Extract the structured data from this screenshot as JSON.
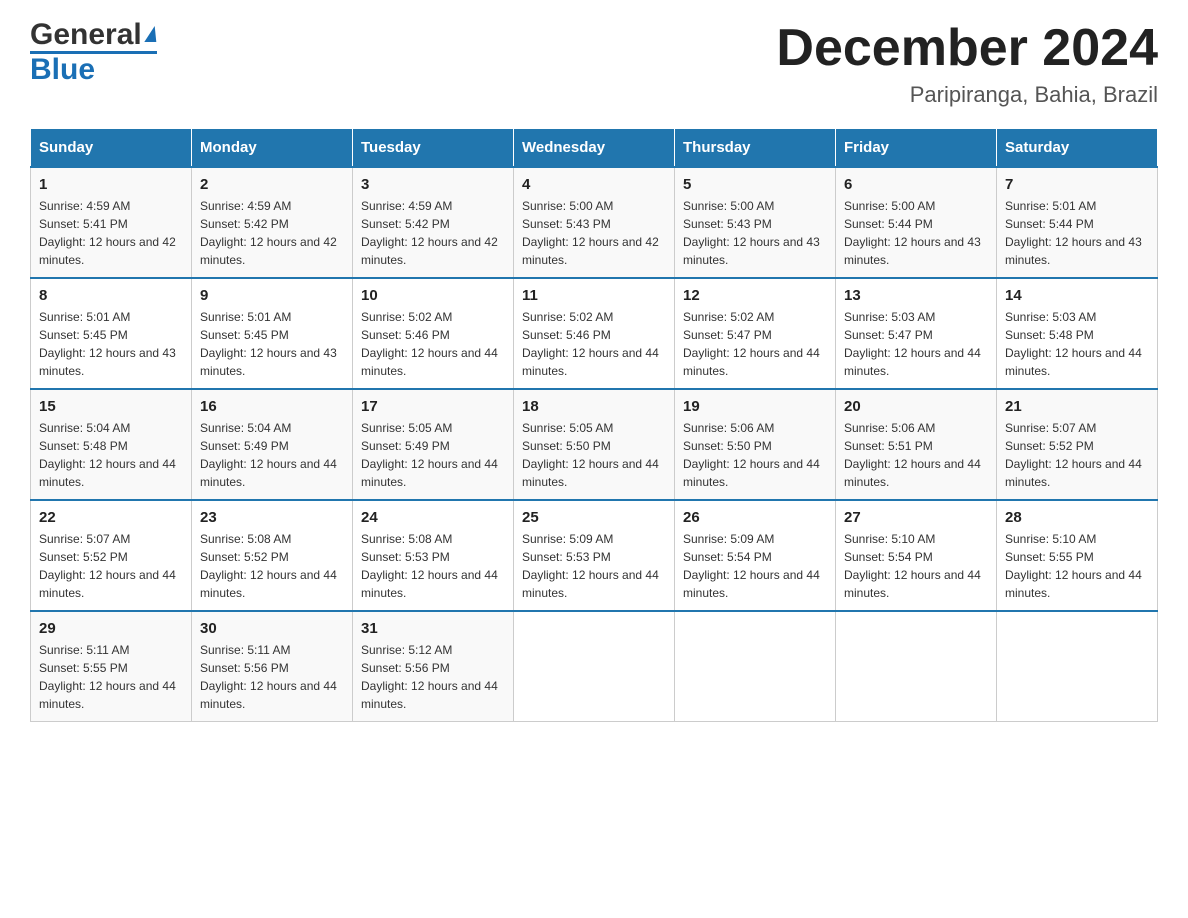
{
  "header": {
    "logo_line1": "General",
    "logo_line2": "Blue",
    "month_title": "December 2024",
    "location": "Paripiranga, Bahia, Brazil"
  },
  "days_of_week": [
    "Sunday",
    "Monday",
    "Tuesday",
    "Wednesday",
    "Thursday",
    "Friday",
    "Saturday"
  ],
  "weeks": [
    [
      {
        "day": "1",
        "sunrise": "Sunrise: 4:59 AM",
        "sunset": "Sunset: 5:41 PM",
        "daylight": "Daylight: 12 hours and 42 minutes."
      },
      {
        "day": "2",
        "sunrise": "Sunrise: 4:59 AM",
        "sunset": "Sunset: 5:42 PM",
        "daylight": "Daylight: 12 hours and 42 minutes."
      },
      {
        "day": "3",
        "sunrise": "Sunrise: 4:59 AM",
        "sunset": "Sunset: 5:42 PM",
        "daylight": "Daylight: 12 hours and 42 minutes."
      },
      {
        "day": "4",
        "sunrise": "Sunrise: 5:00 AM",
        "sunset": "Sunset: 5:43 PM",
        "daylight": "Daylight: 12 hours and 42 minutes."
      },
      {
        "day": "5",
        "sunrise": "Sunrise: 5:00 AM",
        "sunset": "Sunset: 5:43 PM",
        "daylight": "Daylight: 12 hours and 43 minutes."
      },
      {
        "day": "6",
        "sunrise": "Sunrise: 5:00 AM",
        "sunset": "Sunset: 5:44 PM",
        "daylight": "Daylight: 12 hours and 43 minutes."
      },
      {
        "day": "7",
        "sunrise": "Sunrise: 5:01 AM",
        "sunset": "Sunset: 5:44 PM",
        "daylight": "Daylight: 12 hours and 43 minutes."
      }
    ],
    [
      {
        "day": "8",
        "sunrise": "Sunrise: 5:01 AM",
        "sunset": "Sunset: 5:45 PM",
        "daylight": "Daylight: 12 hours and 43 minutes."
      },
      {
        "day": "9",
        "sunrise": "Sunrise: 5:01 AM",
        "sunset": "Sunset: 5:45 PM",
        "daylight": "Daylight: 12 hours and 43 minutes."
      },
      {
        "day": "10",
        "sunrise": "Sunrise: 5:02 AM",
        "sunset": "Sunset: 5:46 PM",
        "daylight": "Daylight: 12 hours and 44 minutes."
      },
      {
        "day": "11",
        "sunrise": "Sunrise: 5:02 AM",
        "sunset": "Sunset: 5:46 PM",
        "daylight": "Daylight: 12 hours and 44 minutes."
      },
      {
        "day": "12",
        "sunrise": "Sunrise: 5:02 AM",
        "sunset": "Sunset: 5:47 PM",
        "daylight": "Daylight: 12 hours and 44 minutes."
      },
      {
        "day": "13",
        "sunrise": "Sunrise: 5:03 AM",
        "sunset": "Sunset: 5:47 PM",
        "daylight": "Daylight: 12 hours and 44 minutes."
      },
      {
        "day": "14",
        "sunrise": "Sunrise: 5:03 AM",
        "sunset": "Sunset: 5:48 PM",
        "daylight": "Daylight: 12 hours and 44 minutes."
      }
    ],
    [
      {
        "day": "15",
        "sunrise": "Sunrise: 5:04 AM",
        "sunset": "Sunset: 5:48 PM",
        "daylight": "Daylight: 12 hours and 44 minutes."
      },
      {
        "day": "16",
        "sunrise": "Sunrise: 5:04 AM",
        "sunset": "Sunset: 5:49 PM",
        "daylight": "Daylight: 12 hours and 44 minutes."
      },
      {
        "day": "17",
        "sunrise": "Sunrise: 5:05 AM",
        "sunset": "Sunset: 5:49 PM",
        "daylight": "Daylight: 12 hours and 44 minutes."
      },
      {
        "day": "18",
        "sunrise": "Sunrise: 5:05 AM",
        "sunset": "Sunset: 5:50 PM",
        "daylight": "Daylight: 12 hours and 44 minutes."
      },
      {
        "day": "19",
        "sunrise": "Sunrise: 5:06 AM",
        "sunset": "Sunset: 5:50 PM",
        "daylight": "Daylight: 12 hours and 44 minutes."
      },
      {
        "day": "20",
        "sunrise": "Sunrise: 5:06 AM",
        "sunset": "Sunset: 5:51 PM",
        "daylight": "Daylight: 12 hours and 44 minutes."
      },
      {
        "day": "21",
        "sunrise": "Sunrise: 5:07 AM",
        "sunset": "Sunset: 5:52 PM",
        "daylight": "Daylight: 12 hours and 44 minutes."
      }
    ],
    [
      {
        "day": "22",
        "sunrise": "Sunrise: 5:07 AM",
        "sunset": "Sunset: 5:52 PM",
        "daylight": "Daylight: 12 hours and 44 minutes."
      },
      {
        "day": "23",
        "sunrise": "Sunrise: 5:08 AM",
        "sunset": "Sunset: 5:52 PM",
        "daylight": "Daylight: 12 hours and 44 minutes."
      },
      {
        "day": "24",
        "sunrise": "Sunrise: 5:08 AM",
        "sunset": "Sunset: 5:53 PM",
        "daylight": "Daylight: 12 hours and 44 minutes."
      },
      {
        "day": "25",
        "sunrise": "Sunrise: 5:09 AM",
        "sunset": "Sunset: 5:53 PM",
        "daylight": "Daylight: 12 hours and 44 minutes."
      },
      {
        "day": "26",
        "sunrise": "Sunrise: 5:09 AM",
        "sunset": "Sunset: 5:54 PM",
        "daylight": "Daylight: 12 hours and 44 minutes."
      },
      {
        "day": "27",
        "sunrise": "Sunrise: 5:10 AM",
        "sunset": "Sunset: 5:54 PM",
        "daylight": "Daylight: 12 hours and 44 minutes."
      },
      {
        "day": "28",
        "sunrise": "Sunrise: 5:10 AM",
        "sunset": "Sunset: 5:55 PM",
        "daylight": "Daylight: 12 hours and 44 minutes."
      }
    ],
    [
      {
        "day": "29",
        "sunrise": "Sunrise: 5:11 AM",
        "sunset": "Sunset: 5:55 PM",
        "daylight": "Daylight: 12 hours and 44 minutes."
      },
      {
        "day": "30",
        "sunrise": "Sunrise: 5:11 AM",
        "sunset": "Sunset: 5:56 PM",
        "daylight": "Daylight: 12 hours and 44 minutes."
      },
      {
        "day": "31",
        "sunrise": "Sunrise: 5:12 AM",
        "sunset": "Sunset: 5:56 PM",
        "daylight": "Daylight: 12 hours and 44 minutes."
      },
      {
        "day": "",
        "sunrise": "",
        "sunset": "",
        "daylight": ""
      },
      {
        "day": "",
        "sunrise": "",
        "sunset": "",
        "daylight": ""
      },
      {
        "day": "",
        "sunrise": "",
        "sunset": "",
        "daylight": ""
      },
      {
        "day": "",
        "sunrise": "",
        "sunset": "",
        "daylight": ""
      }
    ]
  ]
}
